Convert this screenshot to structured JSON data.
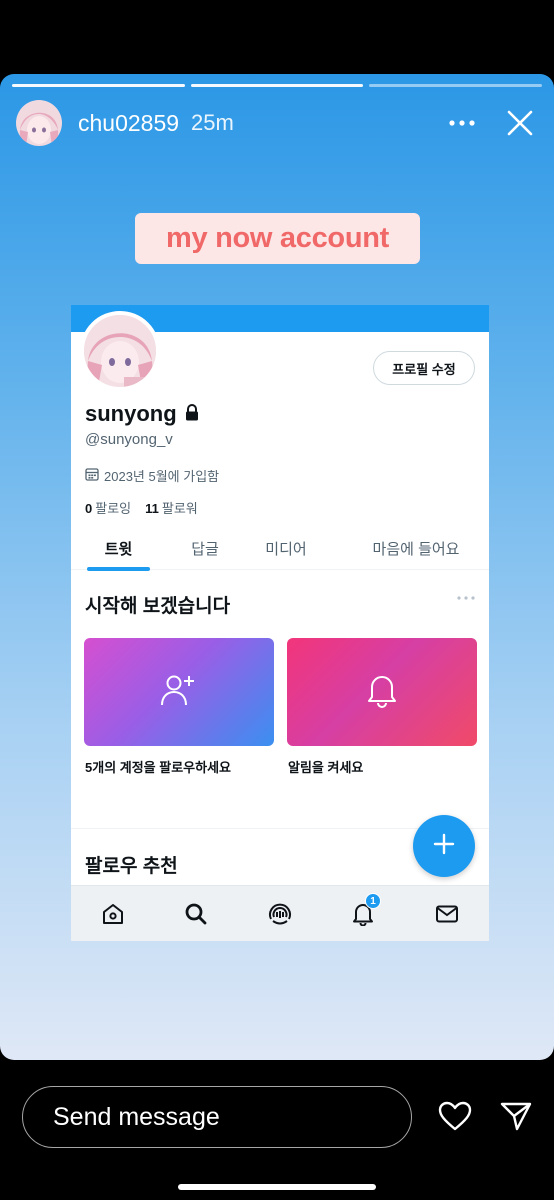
{
  "story": {
    "username": "chu02859",
    "time": "25m",
    "caption": "my now account",
    "progress_segments": 3,
    "progress_done": 2
  },
  "screenshot": {
    "edit_profile_label": "프로필 수정",
    "display_name": "sunyong",
    "handle": "@sunyong_v",
    "joined": "2023년 5월에 가입함",
    "following_count": "0",
    "following_label": "팔로잉",
    "followers_count": "11",
    "followers_label": "팔로워",
    "tabs": [
      "트윗",
      "답글",
      "미디어",
      "마음에 들어요"
    ],
    "active_tab": "트윗",
    "get_started_title": "시작해 보겠습니다",
    "cards": [
      {
        "label": "5개의 계정을 팔로우하세요",
        "icon": "add-user-icon"
      },
      {
        "label": "알림을 켜세요",
        "icon": "bell-icon"
      }
    ],
    "follow_suggestions_title": "팔로우 추천",
    "notification_badge": "1",
    "accent_color": "#1d9bf0"
  },
  "footer": {
    "message_placeholder": "Send message"
  }
}
